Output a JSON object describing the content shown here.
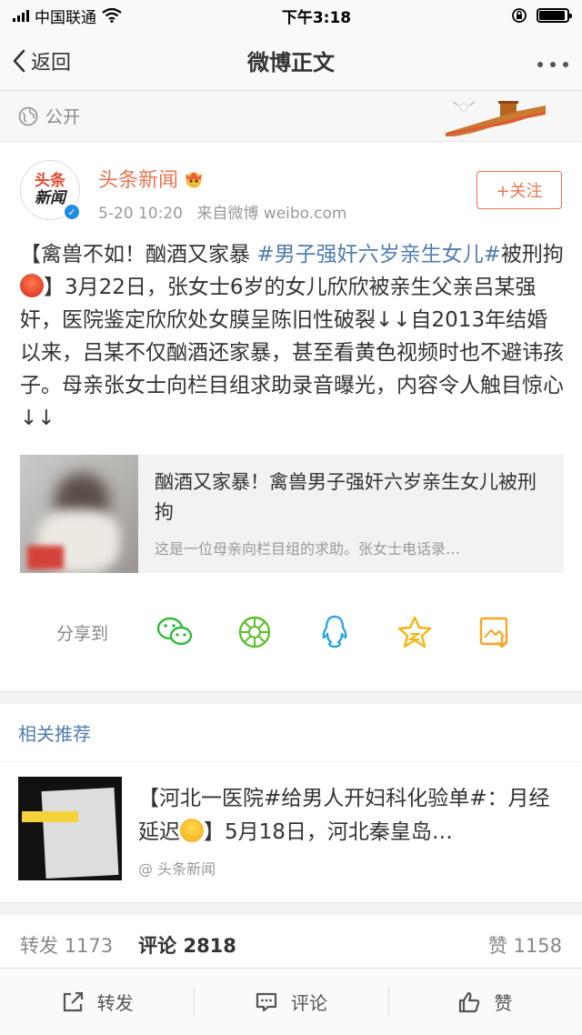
{
  "status_bar": {
    "carrier": "中国联通",
    "time": "下午3:18",
    "battery_level": 0.95
  },
  "nav": {
    "back_label": "返回",
    "title": "微博正文"
  },
  "visibility": {
    "label": "公开"
  },
  "post": {
    "author": {
      "avatar_line1": "头条",
      "avatar_line2": "新闻",
      "name": "头条新闻",
      "time": "5-20 10:20",
      "source": "来自微博 weibo.com"
    },
    "follow_label": "+关注",
    "text_part1": "【禽兽不如！酗酒又家暴 ",
    "hashtag": "#男子强奸六岁亲生女儿#",
    "text_part2": "被刑拘",
    "text_part3": "】3月22日，张女士6岁的女儿欣欣被亲生父亲吕某强奸，医院鉴定欣欣处女膜呈陈旧性破裂↓↓自2013年结婚以来，吕某不仅酗酒还家暴，甚至看黄色视频时也不避讳孩子。母亲张女士向栏目组求助录音曝光，内容令人触目惊心↓↓",
    "link_card": {
      "title": "酗酒又家暴！禽兽男子强奸六岁亲生女儿被刑拘",
      "desc": "这是一位母亲向栏目组的求助。张女士电话录…"
    },
    "share": {
      "label": "分享到",
      "icons": [
        "wechat-icon",
        "moments-icon",
        "qq-icon",
        "qzone-icon",
        "save-image-icon"
      ]
    }
  },
  "related": {
    "heading": "相关推荐",
    "item": {
      "title_part1": "【河北一医院#给男人开妇科化验单#：月经延迟",
      "title_part2": "】5月18日，河北秦皇岛…",
      "source": "@ 头条新闻"
    }
  },
  "stats": {
    "repost_label": "转发",
    "repost_count": "1173",
    "comment_label": "评论",
    "comment_count": "2818",
    "like_label": "赞",
    "like_count": "1158"
  },
  "toolbar": {
    "repost": "转发",
    "comment": "评论",
    "like": "赞"
  },
  "colors": {
    "accent": "#eb7350",
    "link": "#507daf"
  }
}
